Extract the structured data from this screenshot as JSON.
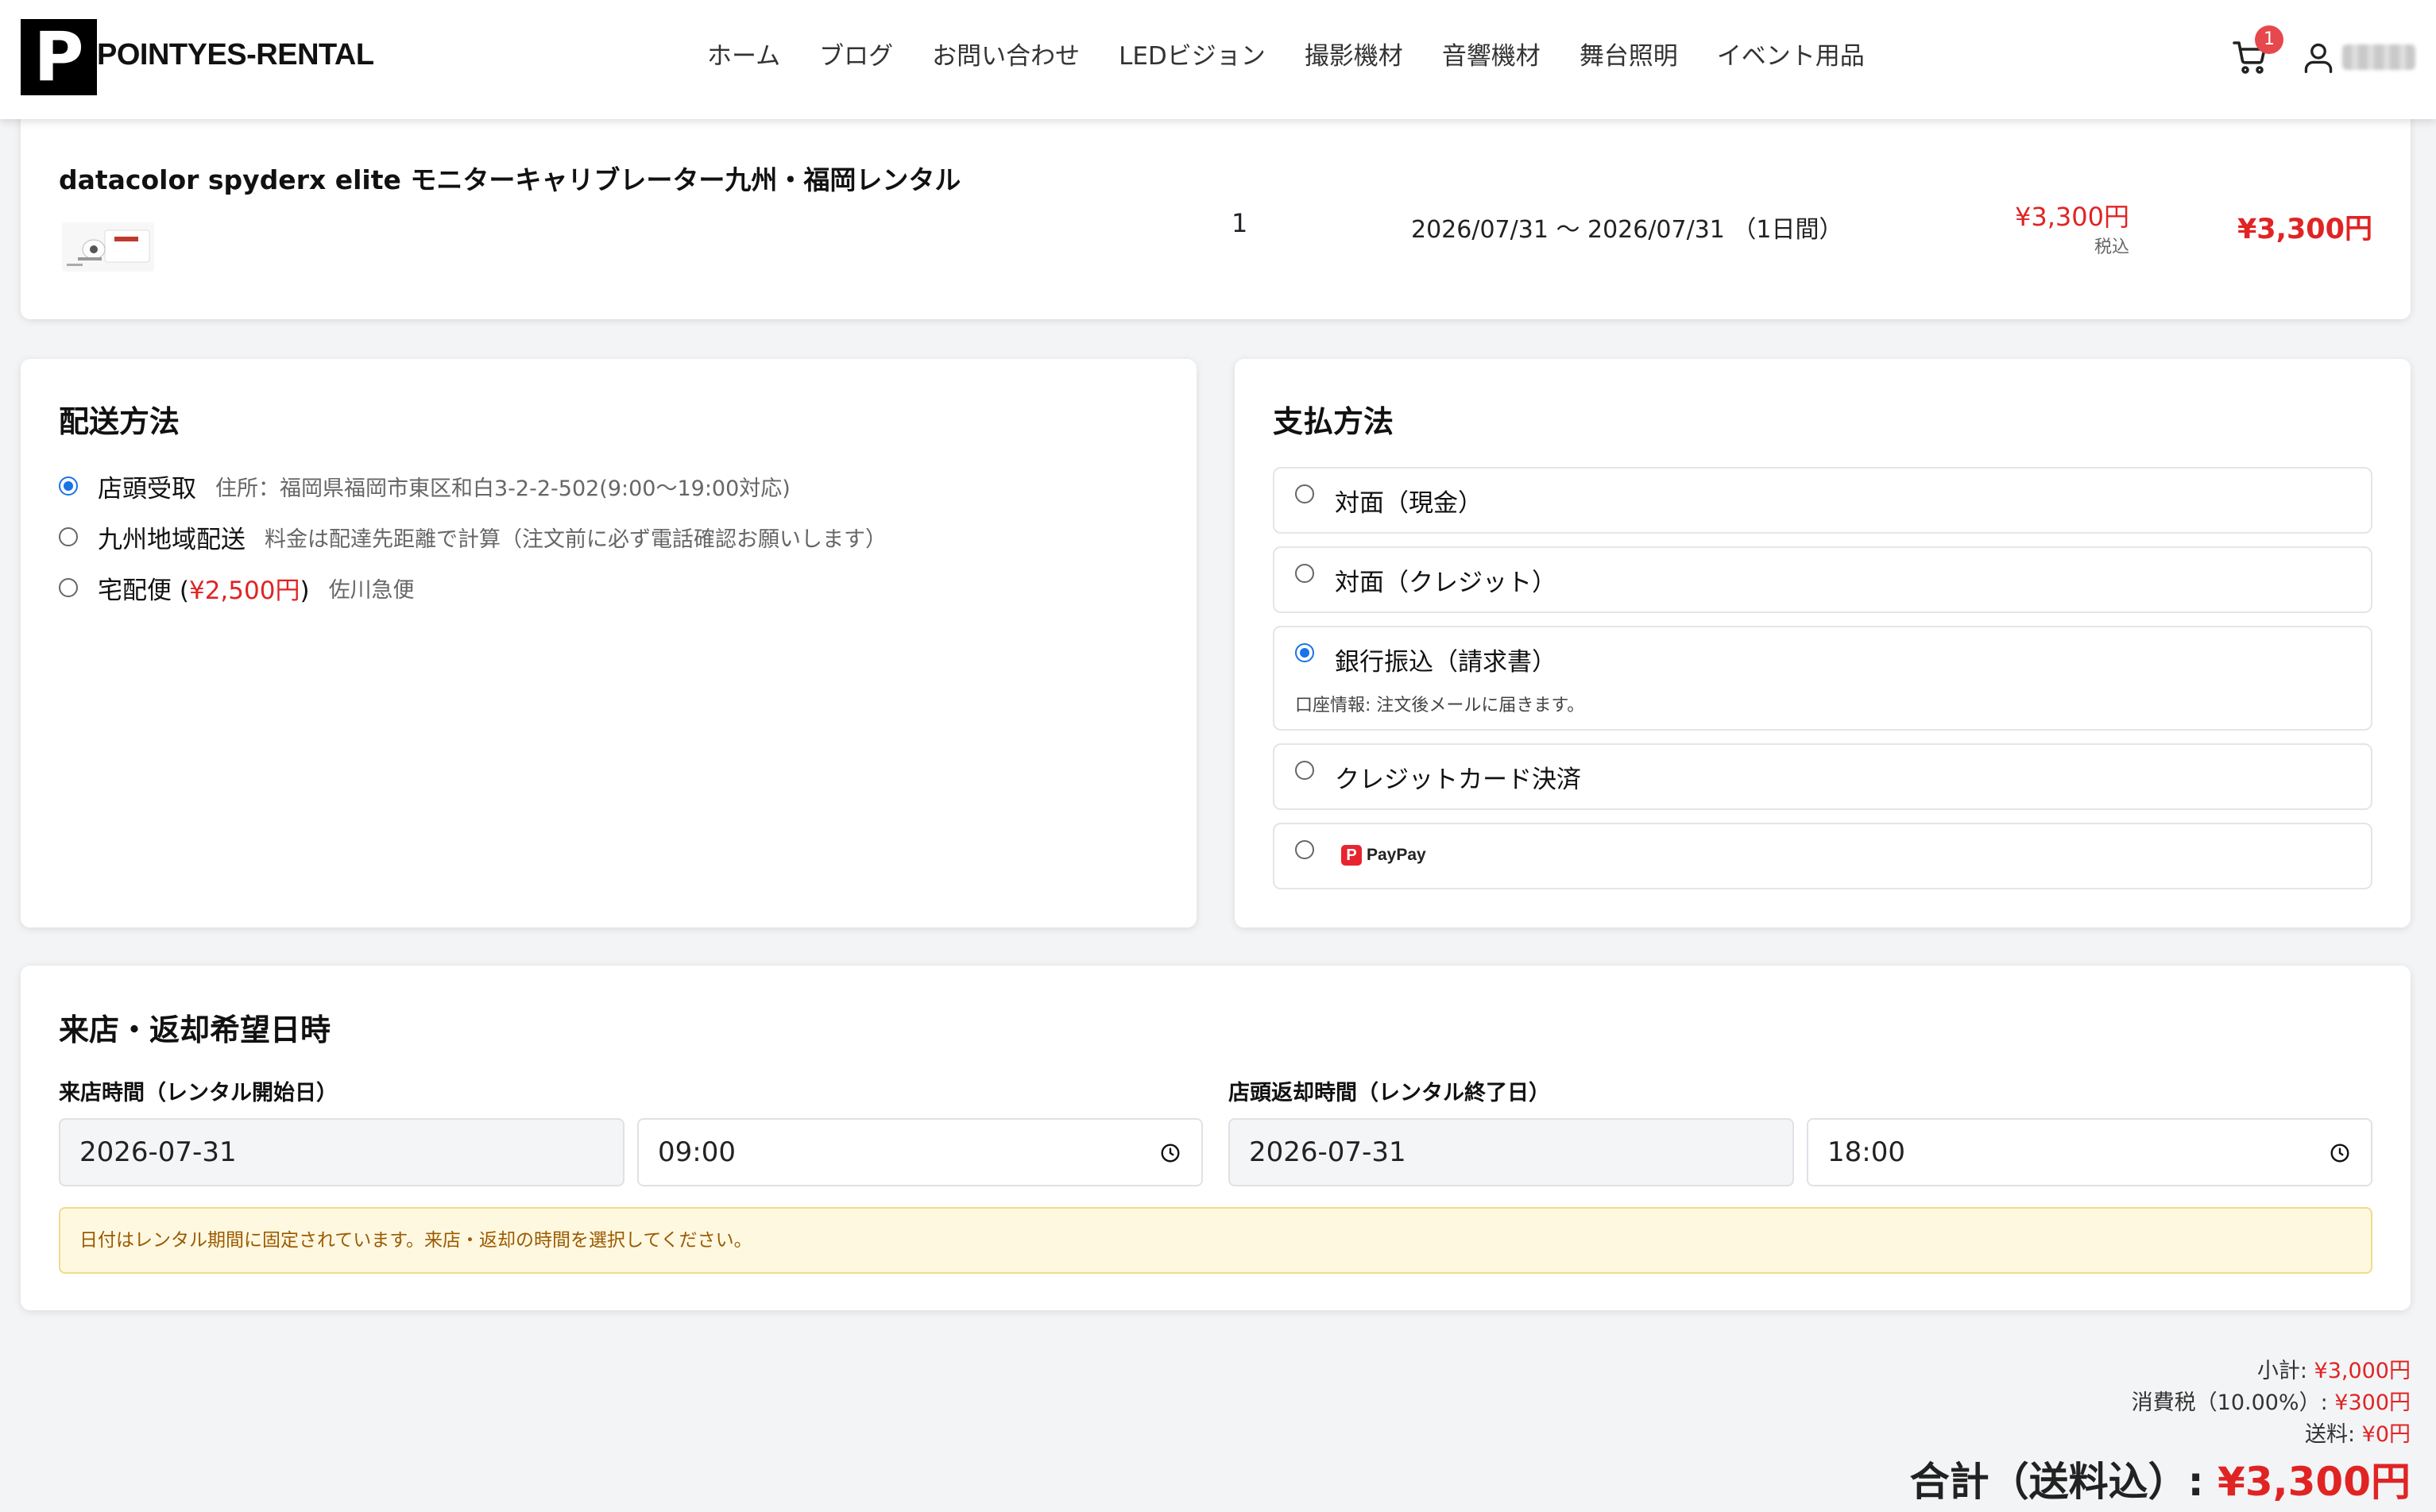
{
  "header": {
    "logo_mark": "P",
    "brand": "POINTYES-RENTAL",
    "nav": [
      "ホーム",
      "ブログ",
      "お問い合わせ",
      "LEDビジョン",
      "撮影機材",
      "音響機材",
      "舞台照明",
      "イベント用品"
    ],
    "cart_count": "1",
    "icons": {
      "cart": "cart-icon",
      "user": "user-icon"
    }
  },
  "product": {
    "title": "datacolor spyderx elite モニターキャリブレーター九州・福岡レンタル",
    "quantity": "1",
    "dates": "2026/07/31 〜 2026/07/31 （1日間）",
    "price": "¥3,300円",
    "tax_label": "税込",
    "line_total": "¥3,300円"
  },
  "shipping": {
    "title": "配送方法",
    "options": [
      {
        "label": "店頭受取",
        "note": "住所：福岡県福岡市東区和白3-2-2-502(9:00〜19:00対応)",
        "checked": true
      },
      {
        "label": "九州地域配送",
        "note": "料金は配達先距離で計算（注文前に必ず電話確認お願いします）",
        "checked": false
      },
      {
        "label": "宅配便",
        "price_open": "(",
        "price": "¥2,500円",
        "price_close": ")",
        "note": "佐川急便",
        "checked": false
      }
    ]
  },
  "payment": {
    "title": "支払方法",
    "options": [
      {
        "label": "対面（現金）",
        "checked": false
      },
      {
        "label": "対面（クレジット）",
        "checked": false
      },
      {
        "label": "銀行振込（請求書）",
        "sub": "口座情報: 注文後メールに届きます。",
        "checked": true
      },
      {
        "label": "クレジットカード決済",
        "checked": false
      },
      {
        "label": "PayPay",
        "checked": false
      }
    ]
  },
  "visit": {
    "title": "来店・返却希望日時",
    "start_label": "来店時間（レンタル開始日）",
    "start_date": "2026-07-31",
    "start_time": "09:00",
    "end_label": "店頭返却時間（レンタル終了日）",
    "end_date": "2026-07-31",
    "end_time": "18:00",
    "notice": "日付はレンタル期間に固定されています。来店・返却の時間を選択してください。"
  },
  "totals": {
    "subtotal_label": "小計: ",
    "subtotal": "¥3,000円",
    "tax_label": "消費税（10.00%）: ",
    "tax": "¥300円",
    "shipping_label": "送料: ",
    "shipping": "¥0円",
    "grand_label": "合計（送料込）: ",
    "grand": "¥3,300円"
  },
  "colors": {
    "accent_red": "#e02424",
    "radio_blue": "#1a73e8",
    "notice_bg": "#fff8e1"
  }
}
